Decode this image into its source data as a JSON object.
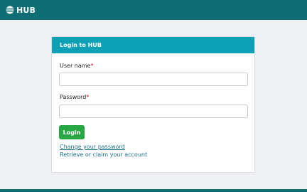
{
  "header": {
    "logo_icon": "hub-logo-icon",
    "brand": "HUB",
    "bar_color": "#0e6e74"
  },
  "login_card": {
    "title": "Login to HUB",
    "header_color": "#0ea0b4",
    "username": {
      "label": "User name",
      "required_mark": "*",
      "value": "",
      "placeholder": ""
    },
    "password": {
      "label": "Password",
      "required_mark": "*",
      "value": "",
      "placeholder": ""
    },
    "login_button": "Login",
    "login_button_color": "#28a745",
    "change_password_link": "Change your password",
    "retrieve_account_link": "Retrieve or claim your account"
  }
}
